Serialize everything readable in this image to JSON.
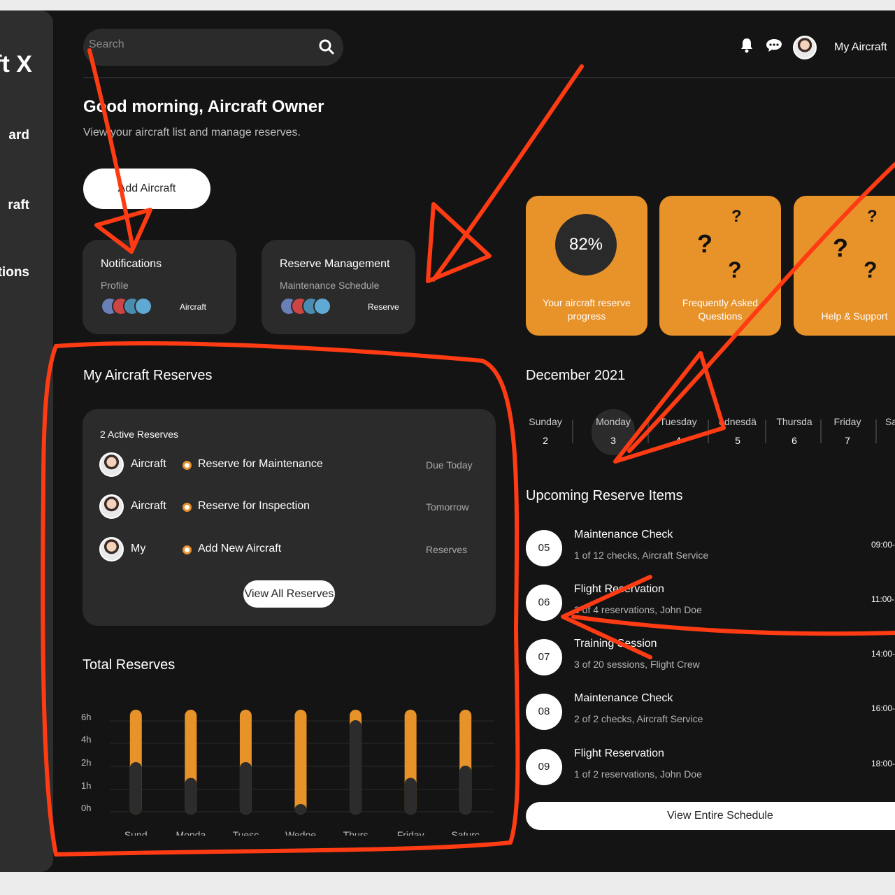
{
  "sidebar": {
    "brand": "ft X",
    "items": [
      {
        "label": "ard"
      },
      {
        "label": "raft"
      },
      {
        "label": "tions"
      }
    ]
  },
  "search": {
    "placeholder": "Search"
  },
  "header": {
    "user_label": "My Aircraft"
  },
  "greeting": {
    "title": "Good morning, Aircraft Owner",
    "subtitle": "View your aircraft list and manage reserves."
  },
  "add_button": "Add Aircraft",
  "cards": [
    {
      "title": "Notifications",
      "subtitle": "Profile",
      "tag": "Aircraft"
    },
    {
      "title": "Reserve Management",
      "subtitle": "Maintenance Schedule",
      "tag": "Reserve"
    }
  ],
  "tiles": [
    {
      "value": "82%",
      "label": "Your aircraft reserve progress",
      "progress": 0.82
    },
    {
      "label": "Frequently Asked Questions"
    },
    {
      "label": "Help & Support"
    }
  ],
  "reserves": {
    "title": "My Aircraft Reserves",
    "count": "2 Active Reserves",
    "rows": [
      {
        "who": "Aircraft",
        "what": "Reserve for Maintenance",
        "when": "Due Today"
      },
      {
        "who": "Aircraft",
        "what": "Reserve for Inspection",
        "when": "Tomorrow"
      },
      {
        "who": "My",
        "what": "Add New Aircraft",
        "when": "Reserves"
      }
    ],
    "view_all": "View All Reserves"
  },
  "chart_title": "Total Reserves",
  "chart_data": {
    "type": "bar",
    "title": "Total Reserves",
    "categories": [
      "Sund",
      "Monda",
      "Tuesc",
      "Wedne",
      "Thurs",
      "Friday",
      "Saturc"
    ],
    "y_ticks": [
      "6h",
      "4h",
      "2h",
      "1h",
      "0h"
    ],
    "series": [
      {
        "values": [
          6,
          6,
          6,
          6,
          6,
          6,
          6
        ]
      },
      {
        "values": [
          3,
          2.1,
          3,
          0.6,
          5.4,
          2.1,
          2.8
        ]
      }
    ],
    "ylim": [
      0,
      6
    ],
    "colors": {
      "background_bar": "#e8922a",
      "foreground_bar": "#2c2c2c"
    }
  },
  "calendar": {
    "month": "December 2021",
    "days": [
      {
        "name": "Sunday",
        "date": "2"
      },
      {
        "name": "Monday",
        "date": "3"
      },
      {
        "name": "Tuesday",
        "date": "4"
      },
      {
        "name": "ednesdä",
        "date": "5"
      },
      {
        "name": "Thursda",
        "date": "6"
      },
      {
        "name": "Friday",
        "date": "7"
      },
      {
        "name": "Sa",
        "date": ""
      }
    ]
  },
  "upcoming": {
    "title": "Upcoming Reserve Items",
    "items": [
      {
        "num": "05",
        "title": "Maintenance Check",
        "desc": "1 of 12 checks, Aircraft Service",
        "time": "09:00-"
      },
      {
        "num": "06",
        "title": "Flight Reservation",
        "desc": "2 of 4 reservations, John Doe",
        "time": "11:00-"
      },
      {
        "num": "07",
        "title": "Training Session",
        "desc": "3 of 20 sessions, Flight Crew",
        "time": "14:00-"
      },
      {
        "num": "08",
        "title": "Maintenance Check",
        "desc": "2 of 2 checks, Aircraft Service",
        "time": "16:00-"
      },
      {
        "num": "09",
        "title": "Flight Reservation",
        "desc": "1 of 2 reservations, John Doe",
        "time": "18:00-"
      }
    ],
    "button": "View Entire Schedule"
  },
  "colors": {
    "accent": "#e8922a",
    "annotation": "#ff3b14",
    "background": "#141414",
    "card": "#2b2b2b"
  }
}
